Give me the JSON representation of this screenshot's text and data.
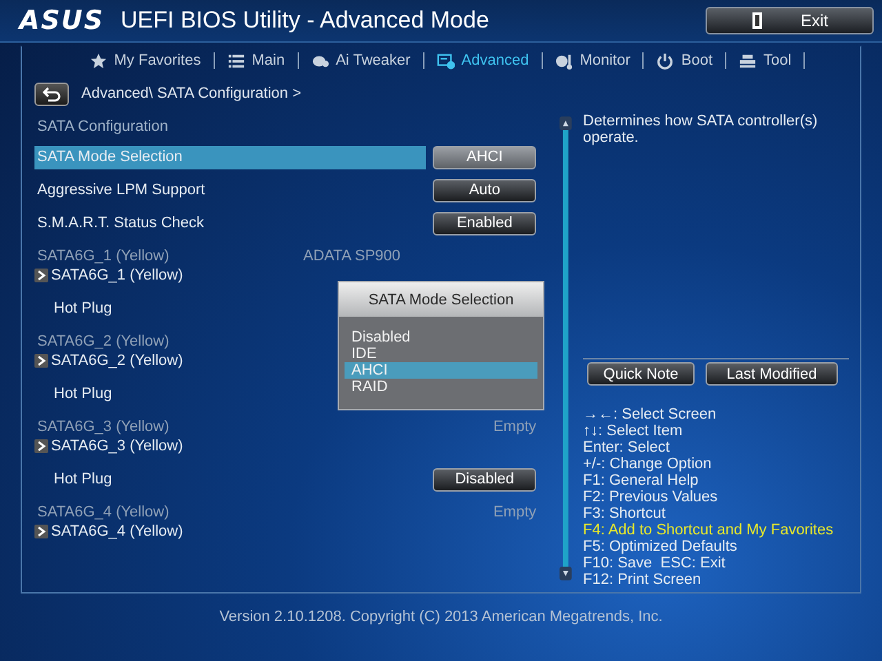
{
  "header": {
    "logo": "ASUS",
    "title": "UEFI BIOS Utility - Advanced Mode",
    "exit_button": "Exit"
  },
  "tabs": [
    {
      "label": "My Favorites",
      "kind": "star",
      "selected": false
    },
    {
      "label": "Main",
      "kind": "list",
      "selected": false
    },
    {
      "label": "Ai Tweaker",
      "kind": "tweaker",
      "selected": false
    },
    {
      "label": "Advanced",
      "kind": "advanced",
      "selected": true
    },
    {
      "label": "Monitor",
      "kind": "monitor",
      "selected": false
    },
    {
      "label": "Boot",
      "kind": "power",
      "selected": false
    },
    {
      "label": "Tool",
      "kind": "tool",
      "selected": false
    }
  ],
  "breadcrumb": "Advanced\\ SATA Configuration >",
  "items": [
    {
      "kind": "heading",
      "label": "SATA Configuration"
    },
    {
      "kind": "option",
      "label": "SATA Mode Selection",
      "value": "AHCI",
      "selected": true
    },
    {
      "kind": "option",
      "label": "Aggressive LPM Support",
      "value": "Auto",
      "selected": false
    },
    {
      "kind": "option",
      "label": "S.M.A.R.T. Status Check",
      "value": "Enabled",
      "selected": false
    },
    {
      "kind": "port",
      "label": "SATA6G_1 (Yellow)",
      "device": "ADATA SP900",
      "link": "SATA6G_1 (Yellow)"
    },
    {
      "kind": "hotplug",
      "label": "Hot Plug"
    },
    {
      "kind": "port",
      "label": "SATA6G_2 (Yellow)",
      "link": "SATA6G_2 (Yellow)"
    },
    {
      "kind": "hotplug",
      "label": "Hot Plug"
    },
    {
      "kind": "port",
      "label": "SATA6G_3 (Yellow)",
      "status": "Empty",
      "link": "SATA6G_3 (Yellow)"
    },
    {
      "kind": "hotplug",
      "label": "Hot Plug",
      "value": "Disabled"
    },
    {
      "kind": "port",
      "label": "SATA6G_4 (Yellow)",
      "status": "Empty",
      "link": "SATA6G_4 (Yellow)"
    }
  ],
  "popup": {
    "title": "SATA Mode Selection",
    "options": [
      {
        "label": "Disabled",
        "selected": false
      },
      {
        "label": "IDE",
        "selected": false
      },
      {
        "label": "AHCI",
        "selected": true
      },
      {
        "label": "RAID",
        "selected": false
      }
    ]
  },
  "description": "Determines how SATA controller(s) operate.",
  "side_buttons": [
    "Quick Note",
    "Last Modified"
  ],
  "help": [
    {
      "text": "→←: Select Screen",
      "highlight": false
    },
    {
      "text": "↑↓: Select Item",
      "highlight": false
    },
    {
      "text": "Enter: Select",
      "highlight": false
    },
    {
      "text": "+/-: Change Option",
      "highlight": false
    },
    {
      "text": "F1: General Help",
      "highlight": false
    },
    {
      "text": "F2: Previous Values",
      "highlight": false
    },
    {
      "text": "F3: Shortcut",
      "highlight": false
    },
    {
      "text": "F4: Add to Shortcut and My Favorites",
      "highlight": true
    },
    {
      "text": "F5: Optimized Defaults",
      "highlight": false
    },
    {
      "text": "F10: Save  ESC: Exit",
      "highlight": false
    },
    {
      "text": "F12: Print Screen",
      "highlight": false
    }
  ],
  "footer": "Version 2.10.1208. Copyright (C) 2013 American Megatrends, Inc."
}
